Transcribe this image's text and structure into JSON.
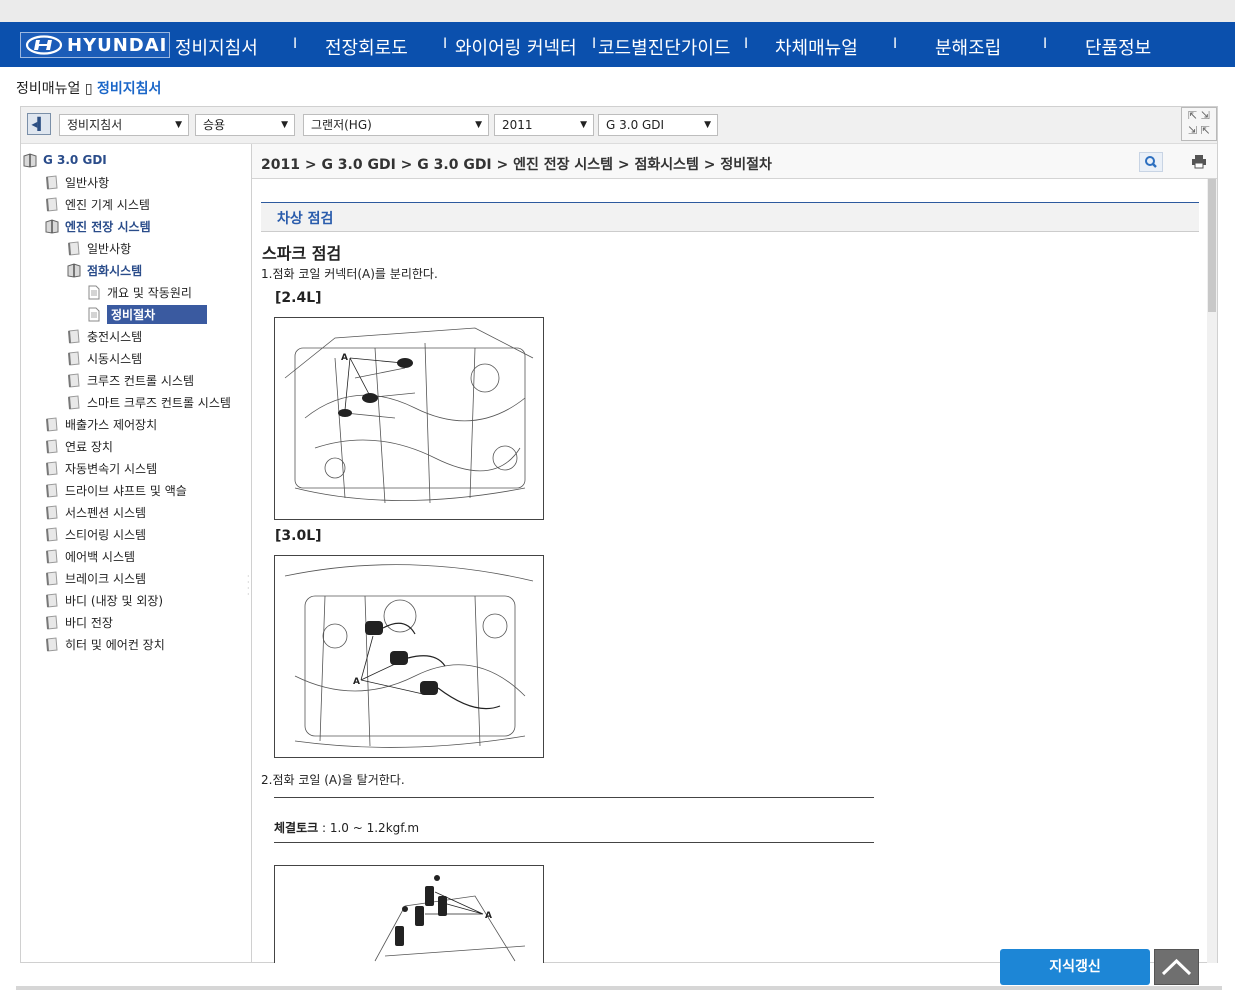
{
  "nav": {
    "brand": "HYUNDAI",
    "items": [
      "정비지침서",
      "전장회로도",
      "와이어링 커넥터",
      "코드별진단가이드",
      "차체매뉴얼",
      "분해조립",
      "단품정보"
    ]
  },
  "breadcrumb": {
    "root": "정비매뉴얼",
    "sep": "▯",
    "current": "정비지침서"
  },
  "selects": {
    "manual": "정비지침서",
    "category": "승용",
    "model": "그랜저(HG)",
    "year": "2011",
    "engine": "G 3.0 GDI"
  },
  "tree": [
    {
      "label": "G 3.0 GDI"
    },
    {
      "label": "일반사항"
    },
    {
      "label": "엔진 기계 시스템"
    },
    {
      "label": "엔진 전장 시스템"
    },
    {
      "label": "일반사항"
    },
    {
      "label": "점화시스템"
    },
    {
      "label": "개요 및 작동원리"
    },
    {
      "label": "정비절차"
    },
    {
      "label": "충전시스템"
    },
    {
      "label": "시동시스템"
    },
    {
      "label": "크루즈 컨트롤 시스템"
    },
    {
      "label": "스마트 크루즈 컨트롤 시스템"
    },
    {
      "label": "배출가스 제어장치"
    },
    {
      "label": "연료 장치"
    },
    {
      "label": "자동변속기 시스템"
    },
    {
      "label": "드라이브 샤프트 및 액슬"
    },
    {
      "label": "서스펜션 시스템"
    },
    {
      "label": "스티어링 시스템"
    },
    {
      "label": "에어백 시스템"
    },
    {
      "label": "브레이크 시스템"
    },
    {
      "label": "바디 (내장 및 외장)"
    },
    {
      "label": "바디 전장"
    },
    {
      "label": "히터 및 에어컨 장치"
    }
  ],
  "content": {
    "crumb": "2011 > G 3.0 GDI > G 3.0 GDI > 엔진 전장 시스템 > 점화시스템 > 정비절차",
    "section": "차상 점검",
    "heading": "스파크 점검",
    "step1": "1.점화 코일 커넥터(A)를 분리한다.",
    "variant1": "[2.4L]",
    "variant2": "[3.0L]",
    "step2": "2.점화 코일 (A)을 탈거한다.",
    "torque_label": "체결토크",
    "torque_value": " : 1.0 ~ 1.2kgf.m",
    "fig_label": "A"
  },
  "buttons": {
    "knowledge": "지식갱신"
  },
  "colors": {
    "nav_bg": "#0b50ad",
    "accent": "#2a5cac",
    "button": "#1d86d6"
  }
}
